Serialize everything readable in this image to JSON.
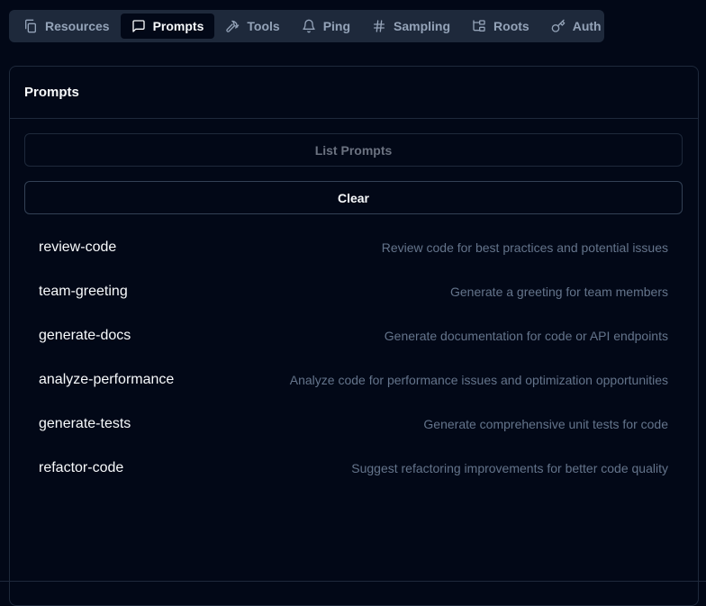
{
  "tabs": [
    {
      "label": "Resources",
      "icon": "files-icon",
      "active": false
    },
    {
      "label": "Prompts",
      "icon": "message-square-icon",
      "active": true
    },
    {
      "label": "Tools",
      "icon": "hammer-icon",
      "active": false
    },
    {
      "label": "Ping",
      "icon": "bell-icon",
      "active": false
    },
    {
      "label": "Sampling",
      "icon": "hash-icon",
      "active": false
    },
    {
      "label": "Roots",
      "icon": "folder-tree-icon",
      "active": false
    },
    {
      "label": "Auth",
      "icon": "key-icon",
      "active": false
    }
  ],
  "panel": {
    "title": "Prompts",
    "list_button": "List Prompts",
    "clear_button": "Clear"
  },
  "prompts": [
    {
      "name": "review-code",
      "description": "Review code for best practices and potential issues"
    },
    {
      "name": "team-greeting",
      "description": "Generate a greeting for team members"
    },
    {
      "name": "generate-docs",
      "description": "Generate documentation for code or API endpoints"
    },
    {
      "name": "analyze-performance",
      "description": "Analyze code for performance issues and optimization opportunities"
    },
    {
      "name": "generate-tests",
      "description": "Generate comprehensive unit tests for code"
    },
    {
      "name": "refactor-code",
      "description": "Suggest refactoring improvements for better code quality"
    }
  ],
  "colors": {
    "background": "#020817",
    "border": "#1e293b",
    "tabbar": "#1e293b",
    "muted_text": "#64748b"
  }
}
